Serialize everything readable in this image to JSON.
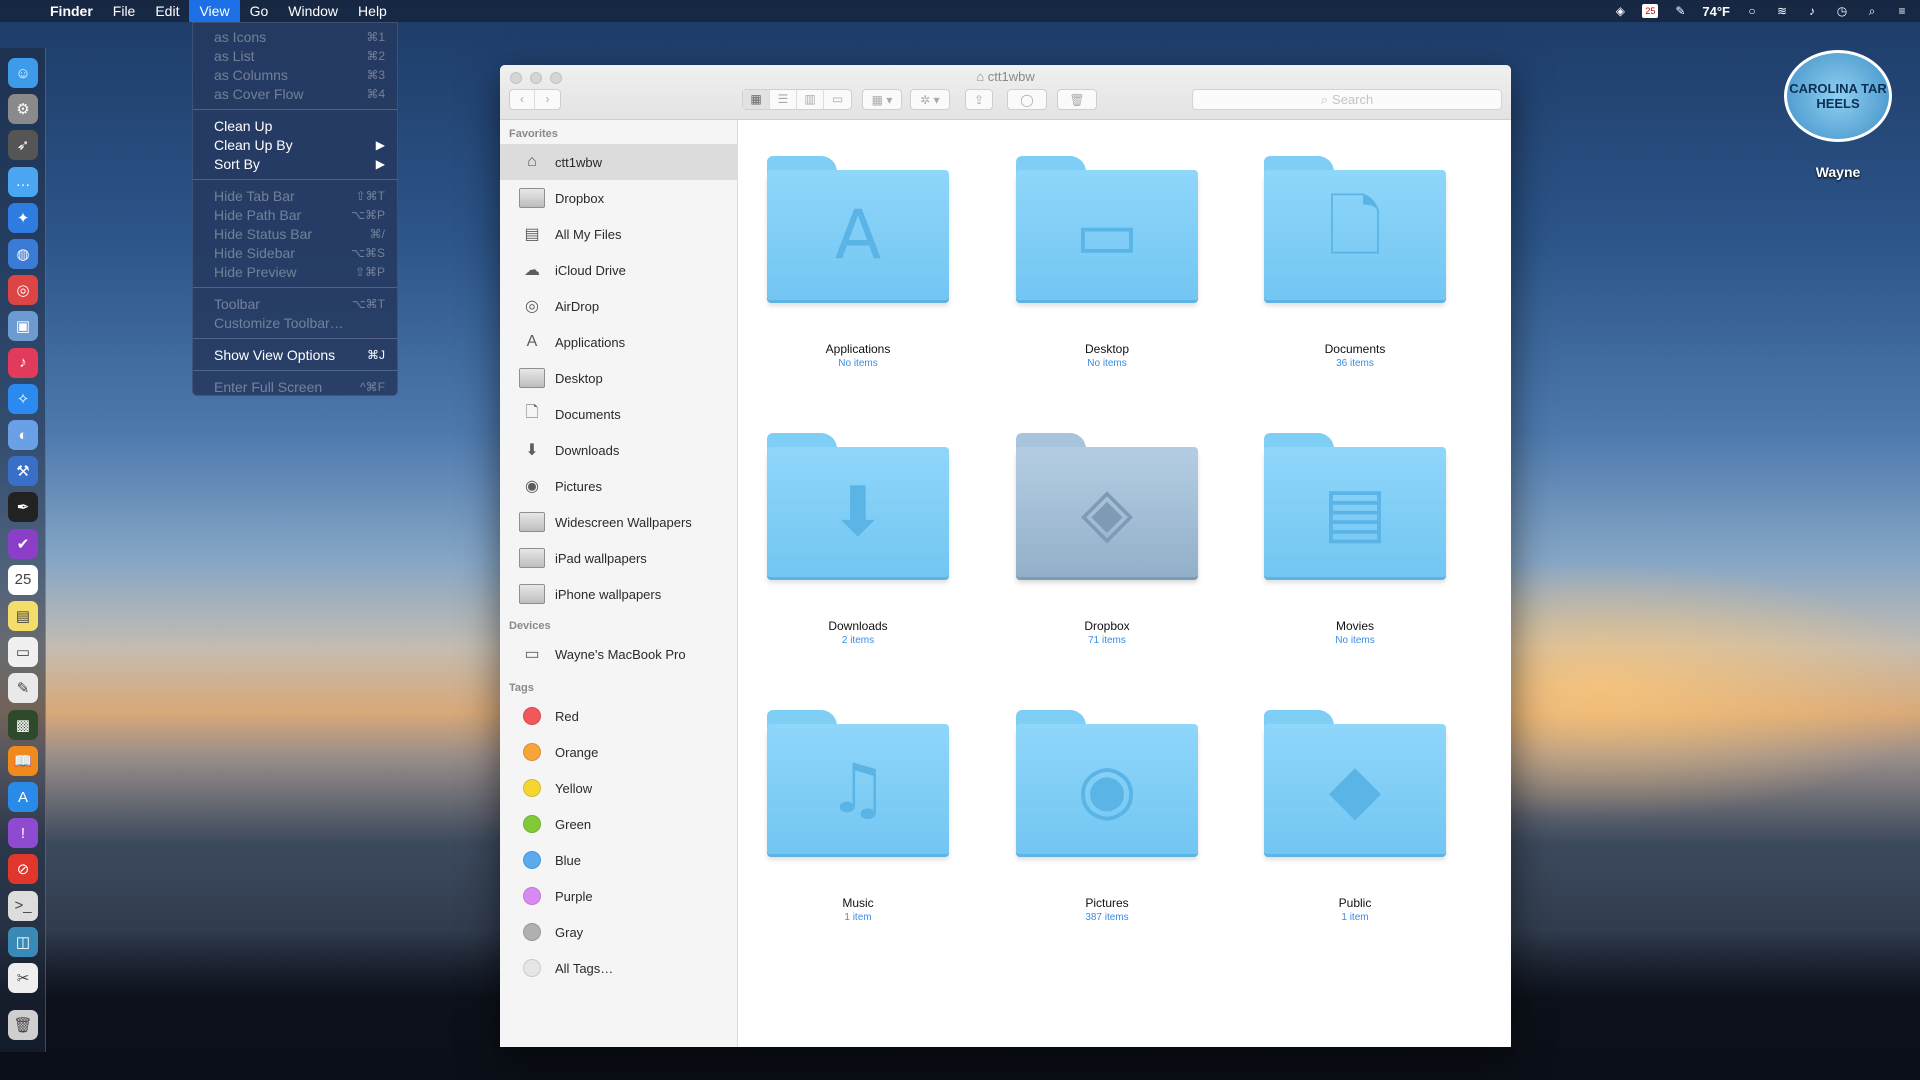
{
  "menubar": {
    "apple": "",
    "app_name": "Finder",
    "menus": [
      "File",
      "Edit",
      "View",
      "Go",
      "Window",
      "Help"
    ],
    "active_menu": "View",
    "status": {
      "temperature": "74°F",
      "calendar_day": "25"
    }
  },
  "view_menu": {
    "groups": [
      [
        {
          "label": "as Icons",
          "shortcut": "⌘1",
          "disabled": true
        },
        {
          "label": "as List",
          "shortcut": "⌘2",
          "disabled": true
        },
        {
          "label": "as Columns",
          "shortcut": "⌘3",
          "disabled": true
        },
        {
          "label": "as Cover Flow",
          "shortcut": "⌘4",
          "disabled": true
        }
      ],
      [
        {
          "label": "Clean Up",
          "shortcut": "",
          "disabled": false
        },
        {
          "label": "Clean Up By",
          "shortcut": "▶",
          "disabled": false
        },
        {
          "label": "Sort By",
          "shortcut": "▶",
          "disabled": false
        }
      ],
      [
        {
          "label": "Hide Tab Bar",
          "shortcut": "⇧⌘T",
          "disabled": true
        },
        {
          "label": "Hide Path Bar",
          "shortcut": "⌥⌘P",
          "disabled": true
        },
        {
          "label": "Hide Status Bar",
          "shortcut": "⌘/",
          "disabled": true
        },
        {
          "label": "Hide Sidebar",
          "shortcut": "⌥⌘S",
          "disabled": true
        },
        {
          "label": "Hide Preview",
          "shortcut": "⇧⌘P",
          "disabled": true
        }
      ],
      [
        {
          "label": "Toolbar",
          "shortcut": "⌥⌘T",
          "disabled": true
        },
        {
          "label": "Customize Toolbar…",
          "shortcut": "",
          "disabled": true
        }
      ],
      [
        {
          "label": "Show View Options",
          "shortcut": "⌘J",
          "disabled": false
        }
      ],
      [
        {
          "label": "Enter Full Screen",
          "shortcut": "^⌘F",
          "disabled": true
        }
      ]
    ]
  },
  "desktop_icon": {
    "badge_text": "CAROLINA TAR HEELS",
    "label": "Wayne"
  },
  "window": {
    "title": "ctt1wbw",
    "search_placeholder": "Search"
  },
  "sidebar": {
    "favorites_header": "Favorites",
    "favorites": [
      {
        "label": "ctt1wbw",
        "icon": "home-icon",
        "selected": true
      },
      {
        "label": "Dropbox",
        "icon": "folder-icon"
      },
      {
        "label": "All My Files",
        "icon": "all-files-icon"
      },
      {
        "label": "iCloud Drive",
        "icon": "cloud-icon"
      },
      {
        "label": "AirDrop",
        "icon": "airdrop-icon"
      },
      {
        "label": "Applications",
        "icon": "applications-icon"
      },
      {
        "label": "Desktop",
        "icon": "desktop-folder-icon"
      },
      {
        "label": "Documents",
        "icon": "documents-icon"
      },
      {
        "label": "Downloads",
        "icon": "downloads-icon"
      },
      {
        "label": "Pictures",
        "icon": "camera-icon"
      },
      {
        "label": "Widescreen Wallpapers",
        "icon": "folder-icon"
      },
      {
        "label": "iPad wallpapers",
        "icon": "folder-icon"
      },
      {
        "label": "iPhone wallpapers",
        "icon": "folder-icon"
      }
    ],
    "devices_header": "Devices",
    "devices": [
      {
        "label": "Wayne's MacBook Pro",
        "icon": "laptop-icon"
      }
    ],
    "tags_header": "Tags",
    "tags": [
      {
        "label": "Red",
        "color": "#f0585c"
      },
      {
        "label": "Orange",
        "color": "#f7a43b"
      },
      {
        "label": "Yellow",
        "color": "#f5d52f"
      },
      {
        "label": "Green",
        "color": "#82c93a"
      },
      {
        "label": "Blue",
        "color": "#5aaaf0"
      },
      {
        "label": "Purple",
        "color": "#d98af0"
      },
      {
        "label": "Gray",
        "color": "#b0b0b0"
      },
      {
        "label": "All Tags…",
        "color": "#e6e6e6"
      }
    ]
  },
  "folders": [
    {
      "name": "Applications",
      "count": "No items",
      "glyph": "A",
      "icon": "applications-folder-icon"
    },
    {
      "name": "Desktop",
      "count": "No items",
      "glyph": "▭",
      "icon": "desktop-folder-icon"
    },
    {
      "name": "Documents",
      "count": "36 items",
      "glyph": "🗋",
      "icon": "documents-folder-icon"
    },
    {
      "name": "Downloads",
      "count": "2 items",
      "glyph": "⬇",
      "icon": "downloads-folder-icon"
    },
    {
      "name": "Dropbox",
      "count": "71 items",
      "glyph": "◈",
      "icon": "dropbox-folder-icon"
    },
    {
      "name": "Movies",
      "count": "No items",
      "glyph": "▤",
      "icon": "movies-folder-icon"
    },
    {
      "name": "Music",
      "count": "1 item",
      "glyph": "♫",
      "icon": "music-folder-icon"
    },
    {
      "name": "Pictures",
      "count": "387 items",
      "glyph": "◉",
      "icon": "pictures-folder-icon"
    },
    {
      "name": "Public",
      "count": "1 item",
      "glyph": "◆",
      "icon": "public-folder-icon"
    }
  ]
}
